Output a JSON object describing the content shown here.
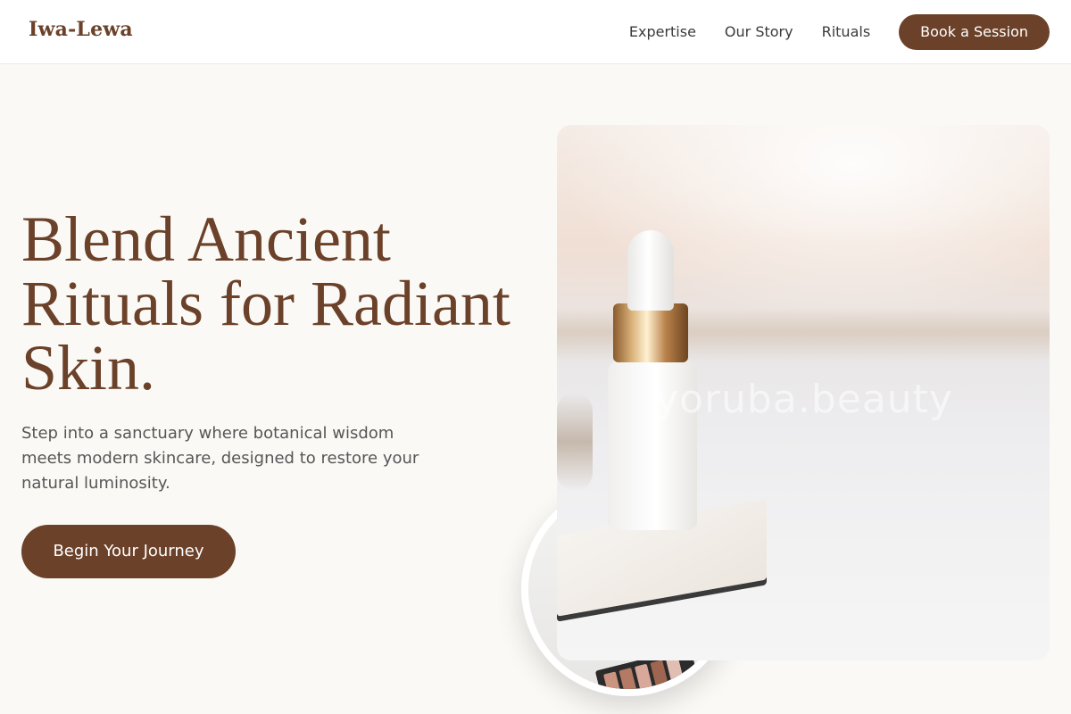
{
  "brand": {
    "name": "Iwa-Lewa"
  },
  "nav": {
    "links": [
      "Expertise",
      "Our Story",
      "Rituals"
    ],
    "cta_label": "Book a Session"
  },
  "hero": {
    "title": "Blend Ancient Rituals for Radiant Skin.",
    "subtitle": "Step into a sanctuary where botanical wisdom meets modern skincare, designed to restore your natural luminosity.",
    "cta_label": "Begin Your Journey"
  },
  "image": {
    "watermark": "yoruba.beauty"
  },
  "colors": {
    "accent": "#6b4129",
    "background": "#fbf9f6"
  }
}
